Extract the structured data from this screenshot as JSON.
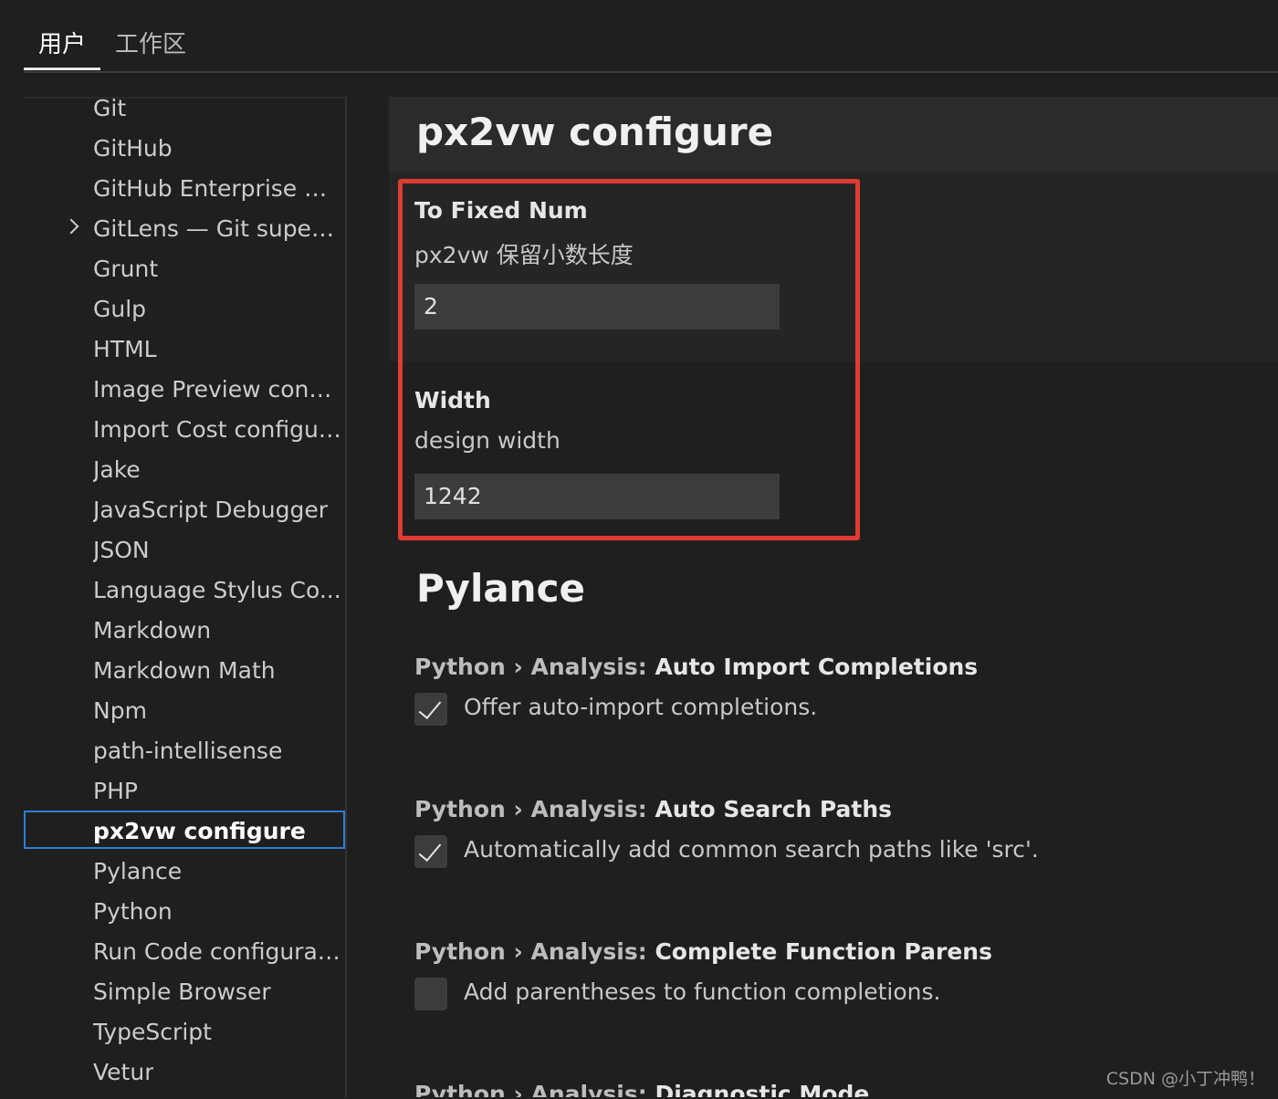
{
  "tabs": {
    "user": "用户",
    "workspace": "工作区"
  },
  "toc": {
    "items": [
      {
        "label": "Git"
      },
      {
        "label": "GitHub"
      },
      {
        "label": "GitHub Enterprise Au..."
      },
      {
        "label": "GitLens — Git superc...",
        "expandable": true
      },
      {
        "label": "Grunt"
      },
      {
        "label": "Gulp"
      },
      {
        "label": "HTML"
      },
      {
        "label": "Image Preview confi..."
      },
      {
        "label": "Import Cost configur..."
      },
      {
        "label": "Jake"
      },
      {
        "label": "JavaScript Debugger"
      },
      {
        "label": "JSON"
      },
      {
        "label": "Language Stylus Co..."
      },
      {
        "label": "Markdown"
      },
      {
        "label": "Markdown Math"
      },
      {
        "label": "Npm"
      },
      {
        "label": "path-intellisense"
      },
      {
        "label": "PHP"
      },
      {
        "label": "px2vw configure",
        "selected": true
      },
      {
        "label": "Pylance"
      },
      {
        "label": "Python"
      },
      {
        "label": "Run Code configurat..."
      },
      {
        "label": "Simple Browser"
      },
      {
        "label": "TypeScript"
      },
      {
        "label": "Vetur"
      }
    ]
  },
  "px2vw": {
    "title": "px2vw configure",
    "to_fixed": {
      "title": "To Fixed Num",
      "description": "px2vw 保留小数长度",
      "value": "2"
    },
    "width": {
      "title": "Width",
      "description": "design width",
      "value": "1242"
    }
  },
  "pylance": {
    "title": "Pylance",
    "settings": [
      {
        "prefix": "Python › Analysis: ",
        "name": "Auto Import Completions",
        "description": "Offer auto-import completions.",
        "checked": true
      },
      {
        "prefix": "Python › Analysis: ",
        "name": "Auto Search Paths",
        "description": "Automatically add common search paths like 'src'.",
        "checked": true
      },
      {
        "prefix": "Python › Analysis: ",
        "name": "Complete Function Parens",
        "description": "Add parentheses to function completions.",
        "checked": false
      },
      {
        "prefix": "Python › Analysis: ",
        "name": "Diagnostic Mode",
        "description": "",
        "checked": false
      }
    ]
  },
  "colors": {
    "highlight_border": "#e03c31",
    "selection_border": "#2f7fd6",
    "background": "#1f1f1f"
  },
  "watermark": "CSDN @小丁冲鸭！"
}
